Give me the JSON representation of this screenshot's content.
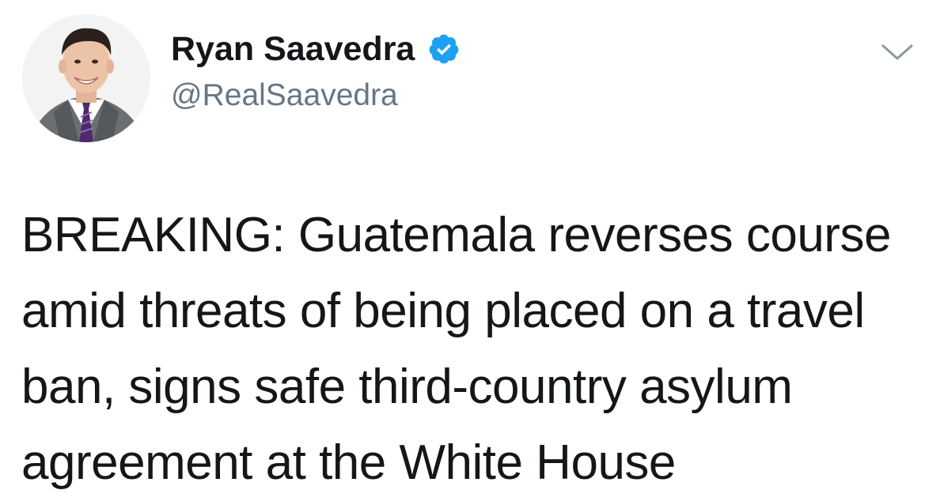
{
  "author": {
    "display_name": "Ryan Saavedra",
    "handle": "@RealSaavedra",
    "verified": true,
    "avatar_icon": "person-photo-avatar"
  },
  "tweet": {
    "lines": [
      "BREAKING: Guatemala reverses course",
      "amid threats of being placed on a travel",
      "ban, signs safe third-country asylum",
      "agreement at the White House"
    ]
  },
  "menu": {
    "icon": "chevron-down-icon"
  },
  "colors": {
    "name": "#14171a",
    "handle": "#657786",
    "verified_badge": "#1da1f2",
    "chevron": "#8899a6",
    "background": "#ffffff"
  }
}
